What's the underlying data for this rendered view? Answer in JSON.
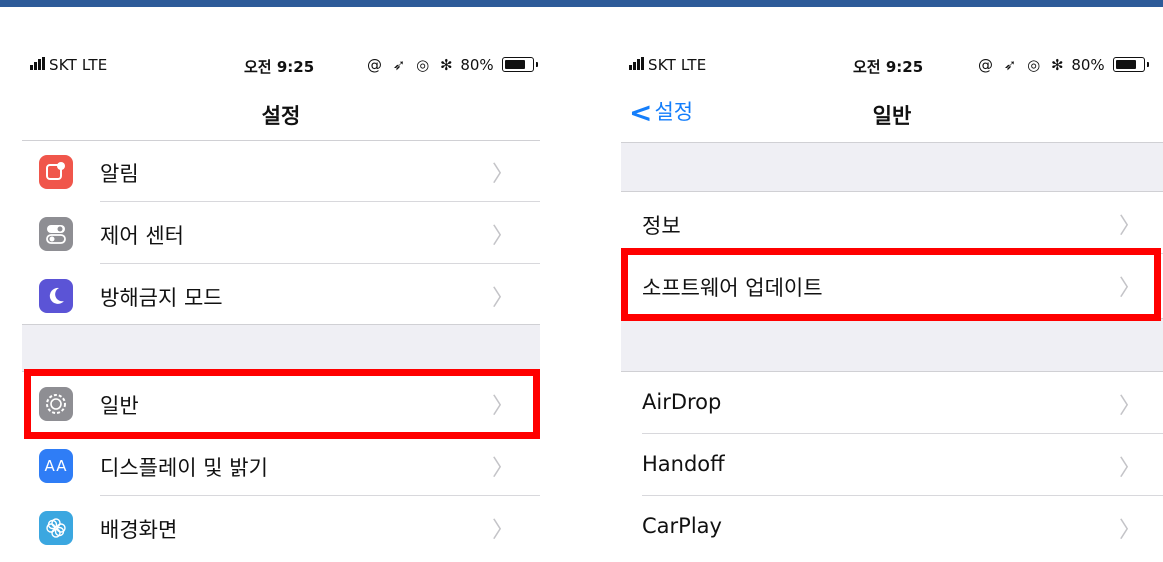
{
  "left": {
    "status": {
      "carrier": "SKT  LTE",
      "time": "오전 9:25",
      "icons": "@ ➶ ◎ ✻",
      "battery": "80%"
    },
    "title": "설정",
    "group1": [
      {
        "label": "알림",
        "icon": "notifications-icon",
        "color": "#f0564b"
      },
      {
        "label": "제어 센터",
        "icon": "control-center-icon",
        "color": "#8e8e93"
      },
      {
        "label": "방해금지 모드",
        "icon": "moon-icon",
        "color": "#5b54d6"
      }
    ],
    "group2": [
      {
        "label": "일반",
        "icon": "gear-icon",
        "color": "#8e8e93"
      },
      {
        "label": "디스플레이 및 밝기",
        "icon": "display-brightness-icon",
        "color": "#2f7df6",
        "glyph": "AA"
      },
      {
        "label": "배경화면",
        "icon": "wallpaper-icon",
        "color": "#3ba7e0"
      }
    ]
  },
  "right": {
    "status": {
      "carrier": "SKT  LTE",
      "time": "오전 9:25",
      "icons": "@ ➶ ◎ ✻",
      "battery": "80%"
    },
    "back_label": "설정",
    "title": "일반",
    "group1": [
      {
        "label": "정보"
      },
      {
        "label": "소프트웨어 업데이트"
      }
    ],
    "group2": [
      {
        "label": "AirDrop"
      },
      {
        "label": "Handoff"
      },
      {
        "label": "CarPlay"
      }
    ]
  },
  "colors": {
    "highlight": "#ff0000",
    "ios_blue": "#147efb",
    "group_bg": "#efeff4"
  }
}
